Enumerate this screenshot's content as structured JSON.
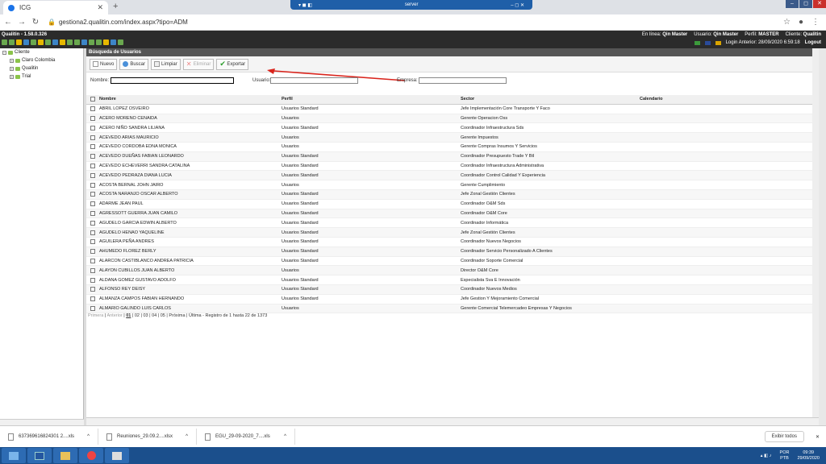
{
  "browser": {
    "tab_title": "ICG",
    "url": "gestiona2.qualitin.com/index.aspx?tipo=ADM",
    "rdp_label": "server"
  },
  "app": {
    "version": "Qualitin - 1.58.0.326",
    "online_label": "En línea:",
    "online_value": "Qin Master",
    "user_label": "Usuario:",
    "user_value": "Qin Master",
    "perfil_label": "Perfil:",
    "perfil_value": "MASTER",
    "client_label": "Cliente:",
    "client_value": "Qualitin",
    "login_text": "Login Anterior: 28/09/2020 6:59:18",
    "logout_label": "Logout"
  },
  "sidebar": {
    "root": "Cliente",
    "items": [
      "Claro Colombia",
      "Qualitin",
      "Trial"
    ]
  },
  "main": {
    "title": "Búsqueda de Usuarios",
    "toolbar": {
      "nuevo": "Nuevo",
      "buscar": "Buscar",
      "limpiar": "Limpiar",
      "eliminar": "Eliminar",
      "exportar": "Exportar"
    },
    "filters": {
      "nombre_label": "Nombre:",
      "usuario_label": "Usuario:",
      "empresa_label": "Empresa:"
    },
    "columns": [
      "Nombre",
      "Perfil",
      "Sector",
      "Calendario"
    ],
    "rows": [
      [
        "ABRIL LOPEZ OSVEIRO",
        "Usuarios Standard",
        "Jefe Implementación Core Transporte Y Faco",
        ""
      ],
      [
        "ACERO MORENO CENAIDA",
        "Usuarios",
        "Gerente Operacion Oss",
        ""
      ],
      [
        "ACERO NIÑO SANDRA LILIANA",
        "Usuarios Standard",
        "Coordinador Infraestructura Sds",
        ""
      ],
      [
        "ACEVEDO ARIAS MAURICIO",
        "Usuarios",
        "Gerente Impuestos",
        ""
      ],
      [
        "ACEVEDO CORDOBA EDNA MONICA",
        "Usuarios",
        "Gerente Compras Insumos Y Servicios",
        ""
      ],
      [
        "ACEVEDO DUEÑAS FABIAN LEONARDO",
        "Usuarios Standard",
        "Coordinador Presupuesto Trade Y Btl",
        ""
      ],
      [
        "ACEVEDO ECHEVERRI SANDRA CATALINA",
        "Usuarios Standard",
        "Coordinador Infraestructura Administrativa",
        ""
      ],
      [
        "ACEVEDO PEDRAZA DIANA LUCIA",
        "Usuarios Standard",
        "Coordinador Control Calidad Y Experiencia",
        ""
      ],
      [
        "ACOSTA BERNAL JOHN JAIRO",
        "Usuarios",
        "Gerente Cumplimiento",
        ""
      ],
      [
        "ACOSTA NARANJO OSCAR ALBERTO",
        "Usuarios Standard",
        "Jefe Zonal Gestión Clientes",
        ""
      ],
      [
        "ADARME JEAN PAUL",
        "Usuarios Standard",
        "Coordinador O&M Sds",
        ""
      ],
      [
        "AGRESSOTT GUERRA JUAN CAMILO",
        "Usuarios Standard",
        "Coordinador O&M Core",
        ""
      ],
      [
        "AGUDELO GARCIA EDWIN ALBERTO",
        "Usuarios Standard",
        "Coordinador Informática",
        ""
      ],
      [
        "AGUDELO HENAO YAQUELINE",
        "Usuarios Standard",
        "Jefe Zonal Gestión Clientes",
        ""
      ],
      [
        "AGUILERA PEÑA ANDRES",
        "Usuarios Standard",
        "Coordinador Nuevos Negocios",
        ""
      ],
      [
        "AHUMEDO FLOREZ BERLY",
        "Usuarios Standard",
        "Coordinador Servicio Personalizado A Clientes",
        ""
      ],
      [
        "ALARCON CASTIBLANCO ANDREA PATRICIA",
        "Usuarios Standard",
        "Coordinador Soporte Comercial",
        ""
      ],
      [
        "ALAYON CUBILLOS JUAN ALBERTO",
        "Usuarios",
        "Director O&M Core",
        ""
      ],
      [
        "ALDANA GOMEZ GUSTAVO ADOLFO",
        "Usuarios Standard",
        "Especialista Sva E Innovación",
        ""
      ],
      [
        "ALFONSO REY DEISY",
        "Usuarios Standard",
        "Coordinador Nuevos Medios",
        ""
      ],
      [
        "ALMANZA CAMPOS FABIAN HERNANDO",
        "Usuarios Standard",
        "Jefe Gestion Y Mejoramiento Comercial",
        ""
      ],
      [
        "ALMARIO GALINDO LUIS CARLOS",
        "Usuarios",
        "Gerente Comercial Telemercadeo Empresas Y Negocios",
        ""
      ]
    ],
    "pager": {
      "primera": "Primera",
      "anterior": "Anterior",
      "pages": [
        "01",
        "02",
        "03",
        "04",
        "05"
      ],
      "proxima": "Próxima",
      "ultima": "Última",
      "registro": "Registro de 1 hasta 22 de 1373"
    }
  },
  "downloads": {
    "items": [
      "637369616824301 2....xls",
      "Reuniones_29.09.2....xlsx",
      "EGU_29-09-2020_7....xls"
    ],
    "show_all": "Exibir todos"
  },
  "taskbar": {
    "lang_top": "POR",
    "lang_bottom": "PTB",
    "time": "09:39",
    "date": "29/09/2020"
  },
  "colors": {
    "accent_arrow": "#d9241c",
    "app_header": "#2b2b2b",
    "taskbar": "#1b4f8c"
  }
}
